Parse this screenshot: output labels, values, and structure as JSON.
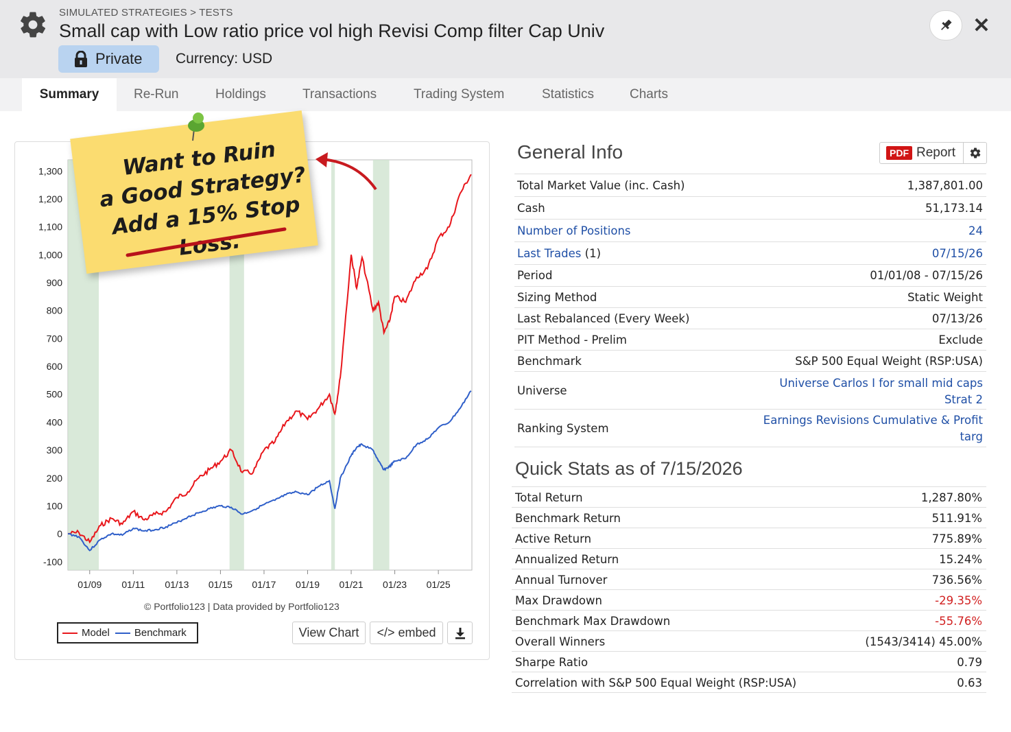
{
  "header": {
    "breadcrumb": "SIMULATED STRATEGIES > TESTS",
    "title": "Small cap with Low ratio price vol high Revisi Comp filter Cap Univ",
    "private_label": "Private",
    "currency": "Currency: USD",
    "icons": [
      "gear-icon",
      "lock-icon",
      "pin-icon",
      "close-icon"
    ]
  },
  "tabs": [
    "Summary",
    "Re-Run",
    "Holdings",
    "Transactions",
    "Trading System",
    "Statistics",
    "Charts"
  ],
  "active_tab": "Summary",
  "sticky_note": {
    "line1": "Want to Ruin",
    "line2": "a Good Strategy?",
    "line3": "Add a 15% Stop Loss."
  },
  "chart_footer": {
    "credit": "© Portfolio123 | Data provided by Portfolio123",
    "legend_model": "Model",
    "legend_benchmark": "Benchmark",
    "view_chart": "View Chart",
    "embed": "</> embed"
  },
  "chart_data": {
    "type": "line",
    "x_ticks": [
      "01/09",
      "01/11",
      "01/13",
      "01/15",
      "01/17",
      "01/19",
      "01/21",
      "01/23",
      "01/25"
    ],
    "y_ticks": [
      "1,300",
      "1,200",
      "1,100",
      "1,000",
      "900",
      "800",
      "700",
      "600",
      "500",
      "400",
      "300",
      "200",
      "100",
      "0",
      "-100"
    ],
    "ylim": [
      -130,
      1340
    ],
    "xlim": [
      "2008-01-01",
      "2026-07-15"
    ],
    "shaded_periods": [
      [
        "2008-01",
        "2009-06"
      ],
      [
        "2015-06",
        "2016-02"
      ],
      [
        "2020-02",
        "2020-04"
      ],
      [
        "2022-01",
        "2022-10"
      ]
    ],
    "colors": {
      "Model": "#e8161b",
      "Benchmark": "#2f5fc9",
      "shading": "#cfe3cf"
    },
    "series": [
      {
        "name": "Model",
        "x": [
          "2008-01",
          "2008-07",
          "2009-01",
          "2009-07",
          "2010-01",
          "2010-07",
          "2011-01",
          "2011-07",
          "2012-01",
          "2012-07",
          "2013-01",
          "2013-07",
          "2014-01",
          "2014-07",
          "2015-01",
          "2015-07",
          "2016-01",
          "2016-07",
          "2017-01",
          "2017-07",
          "2018-01",
          "2018-07",
          "2019-01",
          "2019-07",
          "2020-01",
          "2020-04",
          "2020-07",
          "2021-01",
          "2021-04",
          "2021-07",
          "2022-01",
          "2022-04",
          "2022-07",
          "2022-10",
          "2023-01",
          "2023-07",
          "2024-01",
          "2024-07",
          "2025-01",
          "2025-07",
          "2026-01",
          "2026-07"
        ],
        "values": [
          0,
          5,
          -30,
          30,
          55,
          35,
          80,
          50,
          70,
          80,
          130,
          150,
          200,
          230,
          260,
          300,
          220,
          220,
          300,
          330,
          400,
          440,
          410,
          450,
          500,
          430,
          560,
          1000,
          880,
          990,
          800,
          830,
          720,
          760,
          850,
          830,
          920,
          950,
          1060,
          1100,
          1220,
          1288
        ]
      },
      {
        "name": "Benchmark",
        "x": [
          "2008-01",
          "2008-07",
          "2009-01",
          "2009-07",
          "2010-01",
          "2010-07",
          "2011-01",
          "2011-07",
          "2012-01",
          "2012-07",
          "2013-01",
          "2013-07",
          "2014-01",
          "2014-07",
          "2015-01",
          "2015-07",
          "2016-01",
          "2016-07",
          "2017-01",
          "2017-07",
          "2018-01",
          "2018-07",
          "2019-01",
          "2019-07",
          "2020-01",
          "2020-04",
          "2020-07",
          "2021-01",
          "2021-04",
          "2021-07",
          "2022-01",
          "2022-04",
          "2022-07",
          "2022-10",
          "2023-01",
          "2023-07",
          "2024-01",
          "2024-07",
          "2025-01",
          "2025-07",
          "2026-01",
          "2026-07"
        ],
        "values": [
          0,
          -10,
          -60,
          -20,
          0,
          -5,
          20,
          10,
          15,
          25,
          40,
          60,
          75,
          90,
          100,
          95,
          70,
          85,
          105,
          120,
          140,
          150,
          140,
          170,
          190,
          90,
          200,
          280,
          310,
          320,
          300,
          260,
          230,
          240,
          260,
          270,
          320,
          340,
          380,
          400,
          450,
          512
        ]
      }
    ]
  },
  "general_info": {
    "title": "General Info",
    "report_pdf": "PDF",
    "report_label": "Report",
    "rows": [
      {
        "label": "Total Market Value (inc. Cash)",
        "value": "1,387,801.00"
      },
      {
        "label": "Cash",
        "value": "51,173.14"
      },
      {
        "label": "Number of Positions",
        "value": "24"
      },
      {
        "label": "Last Trades",
        "label_suffix": "(1)",
        "value": "07/15/26"
      },
      {
        "label": "Period",
        "value": "01/01/08 - 07/15/26"
      },
      {
        "label": "Sizing Method",
        "value": "Static Weight"
      },
      {
        "label": "Last Rebalanced (Every Week)",
        "value": "07/13/26"
      },
      {
        "label": "PIT Method - Prelim",
        "value": "Exclude"
      },
      {
        "label": "Benchmark",
        "value": "S&P 500 Equal Weight (RSP:USA)"
      },
      {
        "label": "Universe",
        "value_line1": "Universe Carlos I for small mid caps",
        "value_line2": "Strat 2"
      },
      {
        "label": "Ranking System",
        "value_line1": "Earnings Revisions Cumulative & Profit",
        "value_line2": "targ"
      }
    ]
  },
  "quick_stats": {
    "title": "Quick Stats as of 7/15/2026",
    "rows": [
      {
        "label": "Total Return",
        "value": "1,287.80%"
      },
      {
        "label": "Benchmark Return",
        "value": "511.91%"
      },
      {
        "label": "Active Return",
        "value": "775.89%"
      },
      {
        "label": "Annualized Return",
        "value": "15.24%"
      },
      {
        "label": "Annual Turnover",
        "value": "736.56%"
      },
      {
        "label": "Max Drawdown",
        "value": "-29.35%"
      },
      {
        "label": "Benchmark Max Drawdown",
        "value": "-55.76%"
      },
      {
        "label": "Overall Winners",
        "value": "(1543/3414) 45.00%"
      },
      {
        "label": "Sharpe Ratio",
        "value": "0.79"
      },
      {
        "label": "Correlation with S&P 500 Equal Weight (RSP:USA)",
        "value": "0.63"
      }
    ]
  }
}
